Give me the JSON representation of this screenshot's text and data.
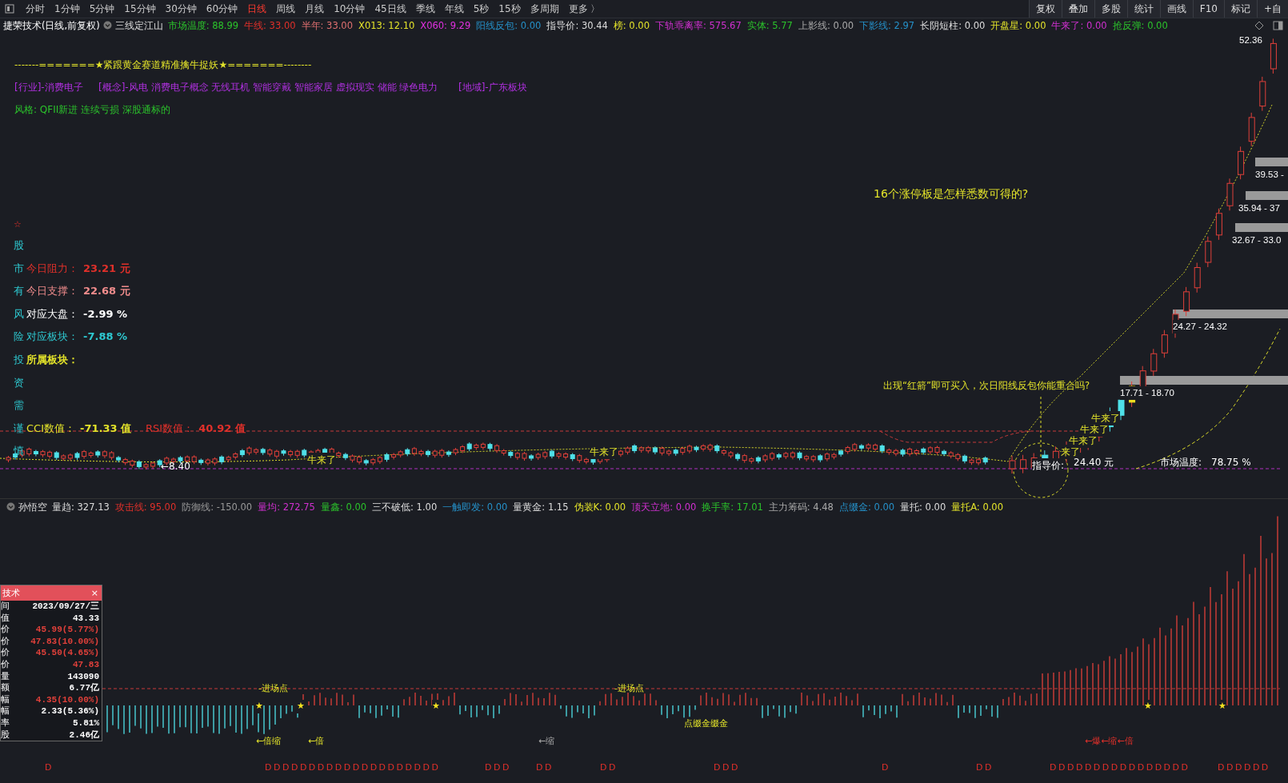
{
  "toolbar": {
    "periods": [
      {
        "label": "分时",
        "selected": false
      },
      {
        "label": "1分钟",
        "selected": false
      },
      {
        "label": "5分钟",
        "selected": false
      },
      {
        "label": "15分钟",
        "selected": false
      },
      {
        "label": "30分钟",
        "selected": false
      },
      {
        "label": "60分钟",
        "selected": false
      },
      {
        "label": "日线",
        "selected": true
      },
      {
        "label": "周线",
        "selected": false
      },
      {
        "label": "月线",
        "selected": false
      },
      {
        "label": "10分钟",
        "selected": false
      },
      {
        "label": "45日线",
        "selected": false
      },
      {
        "label": "季线",
        "selected": false
      },
      {
        "label": "年线",
        "selected": false
      },
      {
        "label": "5秒",
        "selected": false
      },
      {
        "label": "15秒",
        "selected": false
      },
      {
        "label": "多周期",
        "selected": false
      }
    ],
    "more": "更多 〉",
    "tools": [
      "复权",
      "叠加",
      "多股",
      "统计",
      "画线",
      "F10",
      "标记",
      "+自"
    ]
  },
  "main_indicator": {
    "stock": "捷荣技术(日线,前复权)",
    "formula": "三线定江山",
    "values": [
      {
        "label": "市场温度:",
        "value": "88.99",
        "color": "#2bc22b"
      },
      {
        "label": "牛线:",
        "value": "33.00",
        "color": "#e0302a"
      },
      {
        "label": "半年:",
        "value": "33.00",
        "color": "#e07070"
      },
      {
        "label": "X013:",
        "value": "12.10",
        "color": "#e3e32a"
      },
      {
        "label": "X060:",
        "value": "9.29",
        "color": "#e030e0"
      },
      {
        "label": "阳线反包:",
        "value": "0.00",
        "color": "#2590c8"
      },
      {
        "label": "指导价:",
        "value": "30.44",
        "color": "#dddddd"
      },
      {
        "label": "榜:",
        "value": "0.00",
        "color": "#e3e32a"
      },
      {
        "label": "下轨乖离率:",
        "value": "575.67",
        "color": "#d030d0"
      },
      {
        "label": "实体:",
        "value": "5.77",
        "color": "#2bc22b"
      },
      {
        "label": "上影线:",
        "value": "0.00",
        "color": "#aaaaaa"
      },
      {
        "label": "下影线:",
        "value": "2.97",
        "color": "#2590c8"
      },
      {
        "label": "长阴短柱:",
        "value": "0.00",
        "color": "#dddddd"
      },
      {
        "label": "开盘星:",
        "value": "0.00",
        "color": "#e3e32a"
      },
      {
        "label": "牛来了:",
        "value": "0.00",
        "color": "#d030d0"
      },
      {
        "label": "抢反弹:",
        "value": "0.00",
        "color": "#2bc22b"
      }
    ]
  },
  "price_chart": {
    "headline": "-------=======★紧跟黄金赛道精准擒牛捉妖★=======--------",
    "tags": [
      {
        "text": "[行业]-消费电子"
      },
      {
        "text": "[概念]-风电 消费电子概念 无线耳机 智能穿戴 智能家居 虚拟现实 储能 绿色电力"
      },
      {
        "text": "[地域]-广东板块"
      }
    ],
    "style": "风格: QFII新进 连续亏损 深股通标的",
    "side_star": "☆",
    "side_rows": [
      {
        "char": "股",
        "items": []
      },
      {
        "char": "市",
        "items": [
          {
            "label": "今日阻力：",
            "value": "23.21 元",
            "color": "#e0302a"
          }
        ]
      },
      {
        "char": "有",
        "items": [
          {
            "label": "今日支撑：",
            "value": "22.68 元",
            "color": "#f08c8c"
          }
        ]
      },
      {
        "char": "风",
        "items": [
          {
            "label": "对应大盘：",
            "value": "-2.99 %",
            "color": "#ffffff"
          }
        ]
      },
      {
        "char": "险",
        "items": [
          {
            "label": "对应板块：",
            "value": "-7.88 %",
            "color": "#2ec8d0"
          }
        ]
      },
      {
        "char": "投",
        "items": [
          {
            "label": "所属板块：",
            "value": "",
            "color": "#e3e32a"
          }
        ]
      },
      {
        "char": "资",
        "items": []
      },
      {
        "char": "需",
        "items": []
      },
      {
        "char": "谨",
        "items": [
          {
            "label": "CCI数值：",
            "value": "-71.33 值",
            "color": "#e3e32a"
          },
          {
            "label": "RSI数值：",
            "value": "40.92 值",
            "color": "#e0302a"
          }
        ]
      },
      {
        "char": "慎",
        "items": []
      }
    ],
    "question": "16个涨停板是怎样悉数可得的?",
    "annotation": "出现“红箭”即可买入，次日阳线反包你能重合吗?",
    "price_labels": [
      "52.36",
      "39.53 -",
      "35.94 - 37",
      "32.67 - 33.0",
      "24.27 - 24.32",
      "17.71 - 18.70"
    ],
    "low_label": "←8.40",
    "signals": [
      "牛来了",
      "牛来了",
      "牛来了",
      "牛来了",
      "牛来了",
      "来了"
    ],
    "guide": {
      "label": "指导价:",
      "value": "24.40 元"
    },
    "market_temp": {
      "label": "市场温度:",
      "value": "78.75 %"
    }
  },
  "sub_indicator": {
    "formula": "孙悟空",
    "values": [
      {
        "label": "量趋:",
        "value": "327.13",
        "color": "#dddddd"
      },
      {
        "label": "攻击线:",
        "value": "95.00",
        "color": "#e0302a"
      },
      {
        "label": "防御线:",
        "value": "-150.00",
        "color": "#999999"
      },
      {
        "label": "量均:",
        "value": "272.75",
        "color": "#d030d0"
      },
      {
        "label": "量鑫:",
        "value": "0.00",
        "color": "#2bc22b"
      },
      {
        "label": "三不破低:",
        "value": "1.00",
        "color": "#dddddd"
      },
      {
        "label": "一触即发:",
        "value": "0.00",
        "color": "#2590c8"
      },
      {
        "label": "量黄金:",
        "value": "1.15",
        "color": "#dddddd"
      },
      {
        "label": "伪装K:",
        "value": "0.00",
        "color": "#e3e32a"
      },
      {
        "label": "顶天立地:",
        "value": "0.00",
        "color": "#d030d0"
      },
      {
        "label": "换手率:",
        "value": "17.01",
        "color": "#2bc22b"
      },
      {
        "label": "主力筹码:",
        "value": "4.48",
        "color": "#aaaaaa"
      },
      {
        "label": "点缀金:",
        "value": "0.00",
        "color": "#2590c8"
      },
      {
        "label": "量托:",
        "value": "0.00",
        "color": "#dddddd"
      },
      {
        "label": "量托A:",
        "value": "0.00",
        "color": "#e3e32a"
      }
    ]
  },
  "volume_chart": {
    "entry_points": [
      "-进场点",
      "-进场点"
    ],
    "stars": [
      "★",
      "★",
      "★",
      "★",
      "★"
    ],
    "arrows": [
      "←倍缩",
      "←倍",
      "←缩",
      "←爆←缩←倍"
    ],
    "gold_label": "点缀金缀金",
    "d_marks": [
      "D",
      "DDDDDDDDDDDDDDDDDDDD",
      "DDD",
      "DD",
      "DD",
      "DDD",
      "D",
      "DD",
      "DDDDDDDDDDDDDDDD",
      "DDDDDD"
    ]
  },
  "info_panel": {
    "title": "技术",
    "close": "×",
    "rows": [
      {
        "label": "间",
        "value": "2023/09/27/三",
        "color": "#ffffff"
      },
      {
        "label": "值",
        "value": "43.33",
        "color": "#ffffff"
      },
      {
        "label": "价",
        "value": "45.99(5.77%)",
        "color": "#e0403a"
      },
      {
        "label": "价",
        "value": "47.83(10.00%)",
        "color": "#e0403a"
      },
      {
        "label": "价",
        "value": "45.50(4.65%)",
        "color": "#e0403a"
      },
      {
        "label": "价",
        "value": "47.83",
        "color": "#e0403a"
      },
      {
        "label": "量",
        "value": "143090",
        "color": "#ffffff"
      },
      {
        "label": "额",
        "value": "6.77亿",
        "color": "#ffffff"
      },
      {
        "label": "幅",
        "value": "4.35(10.00%)",
        "color": "#e0403a"
      },
      {
        "label": "幅",
        "value": "2.33(5.36%)",
        "color": "#ffffff"
      },
      {
        "label": "率",
        "value": "5.81%",
        "color": "#ffffff"
      },
      {
        "label": "股",
        "value": "2.46亿",
        "color": "#ffffff"
      }
    ]
  }
}
